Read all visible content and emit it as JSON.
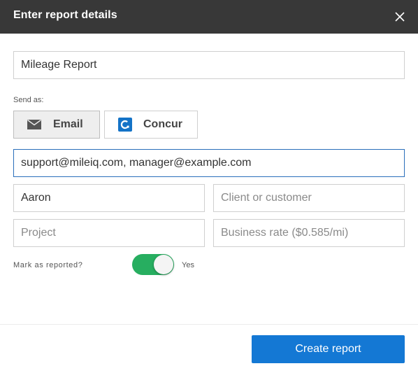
{
  "header": {
    "title": "Enter report details"
  },
  "form": {
    "report_name": {
      "value": "Mileage Report",
      "placeholder": ""
    },
    "send_as_label": "Send as:",
    "send_options": [
      {
        "label": "Email",
        "icon": "envelope-icon",
        "selected": true
      },
      {
        "label": "Concur",
        "icon": "concur-logo-icon",
        "selected": false
      }
    ],
    "recipients": {
      "value": "support@mileiq.com, manager@example.com"
    },
    "name": {
      "value": "Aaron"
    },
    "client": {
      "placeholder": "Client or customer"
    },
    "project": {
      "placeholder": "Project"
    },
    "business_rate": {
      "placeholder": "Business rate ($0.585/mi)"
    },
    "mark_reported": {
      "label": "Mark as reported?",
      "state_label": "Yes",
      "on": true
    }
  },
  "footer": {
    "create_label": "Create report"
  },
  "colors": {
    "header_bg": "#383838",
    "accent": "#1478d4",
    "toggle_on": "#27ae60",
    "focus_border": "#2a6ebb",
    "concur_blue": "#1473c7"
  }
}
